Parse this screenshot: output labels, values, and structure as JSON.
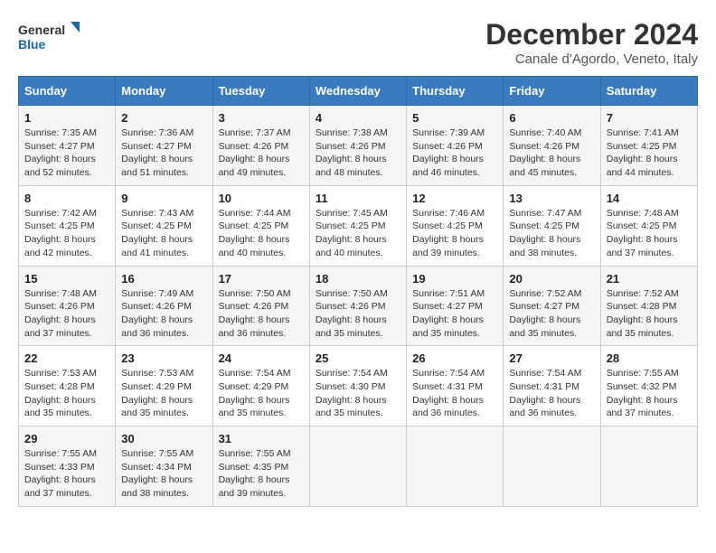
{
  "logo": {
    "line1": "General",
    "line2": "Blue"
  },
  "title": "December 2024",
  "subtitle": "Canale d'Agordo, Veneto, Italy",
  "weekdays": [
    "Sunday",
    "Monday",
    "Tuesday",
    "Wednesday",
    "Thursday",
    "Friday",
    "Saturday"
  ],
  "weeks": [
    [
      {
        "day": "1",
        "sunrise": "7:35 AM",
        "sunset": "4:27 PM",
        "daylight": "8 hours and 52 minutes."
      },
      {
        "day": "2",
        "sunrise": "7:36 AM",
        "sunset": "4:27 PM",
        "daylight": "8 hours and 51 minutes."
      },
      {
        "day": "3",
        "sunrise": "7:37 AM",
        "sunset": "4:26 PM",
        "daylight": "8 hours and 49 minutes."
      },
      {
        "day": "4",
        "sunrise": "7:38 AM",
        "sunset": "4:26 PM",
        "daylight": "8 hours and 48 minutes."
      },
      {
        "day": "5",
        "sunrise": "7:39 AM",
        "sunset": "4:26 PM",
        "daylight": "8 hours and 46 minutes."
      },
      {
        "day": "6",
        "sunrise": "7:40 AM",
        "sunset": "4:26 PM",
        "daylight": "8 hours and 45 minutes."
      },
      {
        "day": "7",
        "sunrise": "7:41 AM",
        "sunset": "4:25 PM",
        "daylight": "8 hours and 44 minutes."
      }
    ],
    [
      {
        "day": "8",
        "sunrise": "7:42 AM",
        "sunset": "4:25 PM",
        "daylight": "8 hours and 42 minutes."
      },
      {
        "day": "9",
        "sunrise": "7:43 AM",
        "sunset": "4:25 PM",
        "daylight": "8 hours and 41 minutes."
      },
      {
        "day": "10",
        "sunrise": "7:44 AM",
        "sunset": "4:25 PM",
        "daylight": "8 hours and 40 minutes."
      },
      {
        "day": "11",
        "sunrise": "7:45 AM",
        "sunset": "4:25 PM",
        "daylight": "8 hours and 40 minutes."
      },
      {
        "day": "12",
        "sunrise": "7:46 AM",
        "sunset": "4:25 PM",
        "daylight": "8 hours and 39 minutes."
      },
      {
        "day": "13",
        "sunrise": "7:47 AM",
        "sunset": "4:25 PM",
        "daylight": "8 hours and 38 minutes."
      },
      {
        "day": "14",
        "sunrise": "7:48 AM",
        "sunset": "4:25 PM",
        "daylight": "8 hours and 37 minutes."
      }
    ],
    [
      {
        "day": "15",
        "sunrise": "7:48 AM",
        "sunset": "4:26 PM",
        "daylight": "8 hours and 37 minutes."
      },
      {
        "day": "16",
        "sunrise": "7:49 AM",
        "sunset": "4:26 PM",
        "daylight": "8 hours and 36 minutes."
      },
      {
        "day": "17",
        "sunrise": "7:50 AM",
        "sunset": "4:26 PM",
        "daylight": "8 hours and 36 minutes."
      },
      {
        "day": "18",
        "sunrise": "7:50 AM",
        "sunset": "4:26 PM",
        "daylight": "8 hours and 35 minutes."
      },
      {
        "day": "19",
        "sunrise": "7:51 AM",
        "sunset": "4:27 PM",
        "daylight": "8 hours and 35 minutes."
      },
      {
        "day": "20",
        "sunrise": "7:52 AM",
        "sunset": "4:27 PM",
        "daylight": "8 hours and 35 minutes."
      },
      {
        "day": "21",
        "sunrise": "7:52 AM",
        "sunset": "4:28 PM",
        "daylight": "8 hours and 35 minutes."
      }
    ],
    [
      {
        "day": "22",
        "sunrise": "7:53 AM",
        "sunset": "4:28 PM",
        "daylight": "8 hours and 35 minutes."
      },
      {
        "day": "23",
        "sunrise": "7:53 AM",
        "sunset": "4:29 PM",
        "daylight": "8 hours and 35 minutes."
      },
      {
        "day": "24",
        "sunrise": "7:54 AM",
        "sunset": "4:29 PM",
        "daylight": "8 hours and 35 minutes."
      },
      {
        "day": "25",
        "sunrise": "7:54 AM",
        "sunset": "4:30 PM",
        "daylight": "8 hours and 35 minutes."
      },
      {
        "day": "26",
        "sunrise": "7:54 AM",
        "sunset": "4:31 PM",
        "daylight": "8 hours and 36 minutes."
      },
      {
        "day": "27",
        "sunrise": "7:54 AM",
        "sunset": "4:31 PM",
        "daylight": "8 hours and 36 minutes."
      },
      {
        "day": "28",
        "sunrise": "7:55 AM",
        "sunset": "4:32 PM",
        "daylight": "8 hours and 37 minutes."
      }
    ],
    [
      {
        "day": "29",
        "sunrise": "7:55 AM",
        "sunset": "4:33 PM",
        "daylight": "8 hours and 37 minutes."
      },
      {
        "day": "30",
        "sunrise": "7:55 AM",
        "sunset": "4:34 PM",
        "daylight": "8 hours and 38 minutes."
      },
      {
        "day": "31",
        "sunrise": "7:55 AM",
        "sunset": "4:35 PM",
        "daylight": "8 hours and 39 minutes."
      },
      null,
      null,
      null,
      null
    ]
  ]
}
